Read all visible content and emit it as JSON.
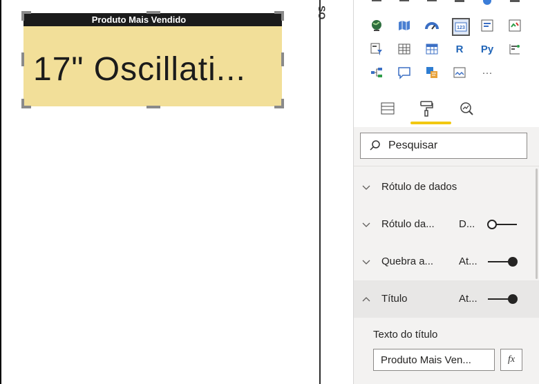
{
  "card": {
    "title": "Produto Mais Vendido",
    "value": "17\" Oscillati..."
  },
  "side_strip_label": "SO",
  "search": {
    "placeholder": "Pesquisar"
  },
  "format_rows": [
    {
      "label": "Rótulo de dados",
      "value": "",
      "toggle": "none",
      "expanded": false
    },
    {
      "label": "Rótulo da...",
      "value": "D...",
      "toggle": "off",
      "expanded": false
    },
    {
      "label": "Quebra a...",
      "value": "At...",
      "toggle": "on",
      "expanded": false
    },
    {
      "label": "Título",
      "value": "At...",
      "toggle": "on",
      "expanded": true
    }
  ],
  "title_section": {
    "field_label": "Texto do título",
    "field_value": "Produto Mais Ven...",
    "fx_label": "fx"
  },
  "gallery_text": {
    "r": "R",
    "py": "Py",
    "more": "···"
  },
  "colors": {
    "card_bg": "#f2df99",
    "accent": "#f2c811",
    "title_bar": "#1b1b1b"
  }
}
